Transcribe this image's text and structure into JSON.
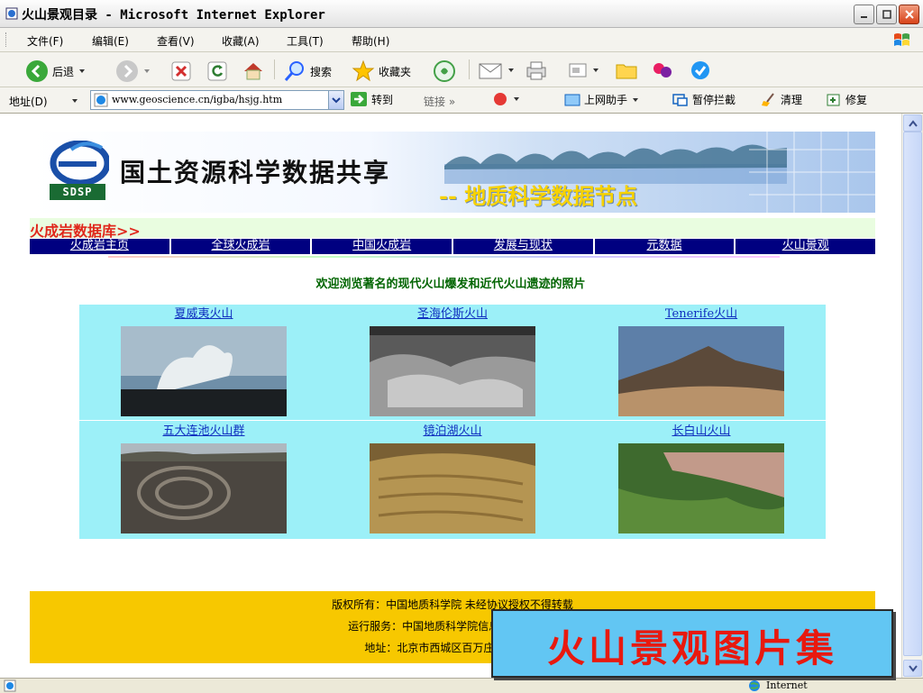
{
  "window": {
    "title": "火山景观目录 - Microsoft Internet Explorer"
  },
  "menu": [
    "文件(F)",
    "编辑(E)",
    "查看(V)",
    "收藏(A)",
    "工具(T)",
    "帮助(H)"
  ],
  "toolbar": {
    "back": "后退",
    "search": "搜索",
    "favorites": "收藏夹"
  },
  "address": {
    "label": "地址(D)",
    "url": "www.geoscience.cn/igba/hsjg.htm",
    "go": "转到",
    "links": "链接",
    "assistant": "上网助手",
    "block": "暂停拦截",
    "clean": "清理",
    "repair": "修复"
  },
  "page": {
    "banner": {
      "logo_text": "SDSP",
      "title": "国土资源科学数据共享",
      "subtitle": "-- 地质科学数据节点"
    },
    "section": "火成岩数据库>>",
    "nav": [
      "火成岩主页",
      "全球火成岩",
      "中国火成岩",
      "发展与现状",
      "元数据",
      "火山景观"
    ],
    "welcome": "欢迎浏览著名的现代火山爆发和近代火山遗迹的照片",
    "gallery": [
      {
        "caption": "夏威夷火山",
        "photo": "hawaii-volcano-photo"
      },
      {
        "caption": "圣海伦斯火山",
        "photo": "st-helens-volcano-photo"
      },
      {
        "caption": "Tenerife火山",
        "photo": "tenerife-volcano-photo"
      },
      {
        "caption": "五大连池火山群",
        "photo": "wudalianchi-volcano-photo"
      },
      {
        "caption": "镜泊湖火山",
        "photo": "jingpohu-volcano-photo"
      },
      {
        "caption": "长白山火山",
        "photo": "changbaishan-volcano-photo"
      }
    ],
    "footer": {
      "copyright": "版权所有：中国地质科学院    未经协议授权不得转载",
      "service": "运行服务：中国地质科学院信息中心   电话：",
      "address": "地址：北京市西城区百万庄大街26号"
    }
  },
  "overlay": {
    "text": "火山景观图片集"
  },
  "status": {
    "zone": "Internet"
  },
  "colors": {
    "nav_bg": "#000080",
    "gallery_bg": "#9cf0f8",
    "footer_bg": "#f7c800",
    "overlay_bg": "#62c6f3",
    "overlay_text": "#e8190f",
    "section_text": "#e0261b"
  }
}
